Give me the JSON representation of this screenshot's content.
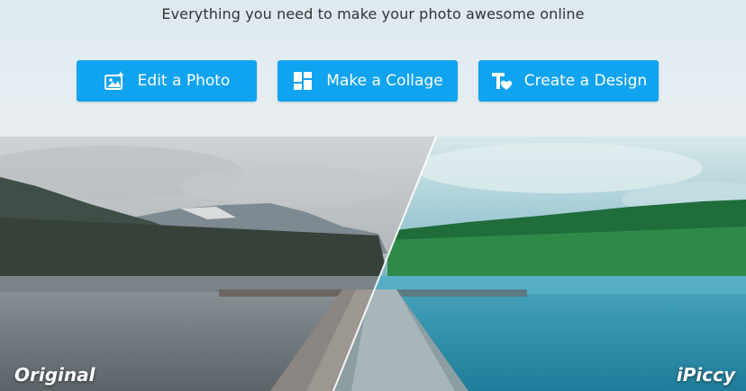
{
  "tagline": "Everything you need to make your photo awesome online",
  "buttons": {
    "edit": {
      "label": "Edit a Photo",
      "icon": "photo-sparkle-icon"
    },
    "collage": {
      "label": "Make a Collage",
      "icon": "collage-grid-icon"
    },
    "design": {
      "label": "Create a Design",
      "icon": "text-heart-icon"
    }
  },
  "comparison": {
    "left_label": "Original",
    "right_label": "iPiccy"
  },
  "colors": {
    "accent": "#10a3f0",
    "text": "#333333"
  }
}
